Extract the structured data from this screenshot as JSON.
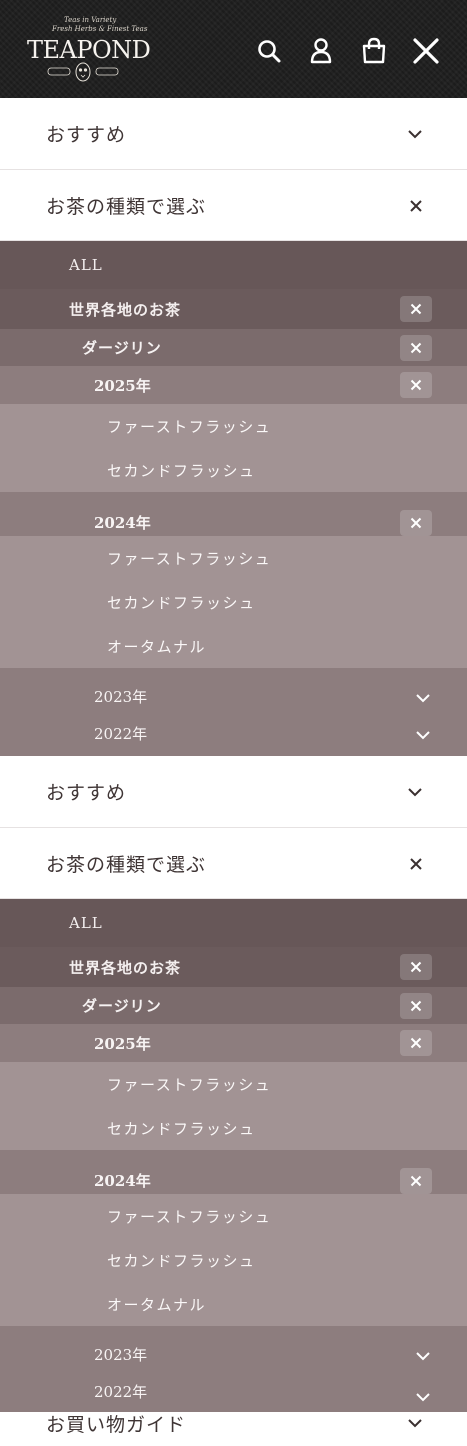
{
  "header": {
    "logo": {
      "wordmark": "TEAPOND",
      "tagline_1": "Teas in Variety",
      "tagline_2": "Fresh Herbs & Finest Teas"
    },
    "icons": [
      "search-icon",
      "account-icon",
      "cart-icon",
      "close-icon"
    ]
  },
  "menus": [
    {
      "recommend": "おすすめ",
      "tea_types": "お茶の種類で選ぶ",
      "all": "ALL",
      "world": "世界各地のお茶",
      "darjeeling": "ダージリン",
      "y2025": "2025年",
      "y2025_items": [
        "ファーストフラッシュ",
        "セカンドフラッシュ"
      ],
      "y2024": "2024年",
      "y2024_items": [
        "ファーストフラッシュ",
        "セカンドフラッシュ",
        "オータムナル"
      ],
      "y2023": "2023年",
      "y2022": "2022年"
    },
    {
      "recommend": "おすすめ",
      "tea_types": "お茶の種類で選ぶ",
      "all": "ALL",
      "world": "世界各地のお茶",
      "darjeeling": "ダージリン",
      "y2025": "2025年",
      "y2025_items": [
        "ファーストフラッシュ",
        "セカンドフラッシュ"
      ],
      "y2024": "2024年",
      "y2024_items": [
        "ファーストフラッシュ",
        "セカンドフラッシュ",
        "オータムナル"
      ],
      "y2023": "2023年",
      "y2022": "2022年"
    }
  ],
  "shopping_guide": "お買い物ガイド",
  "colors": {
    "header_bg": "#1c1c1c",
    "level1_bg": "#675758",
    "level2_bg": "#7b6b6c",
    "level3_bg": "#8d7d7e",
    "level4_bg": "#a29394"
  }
}
